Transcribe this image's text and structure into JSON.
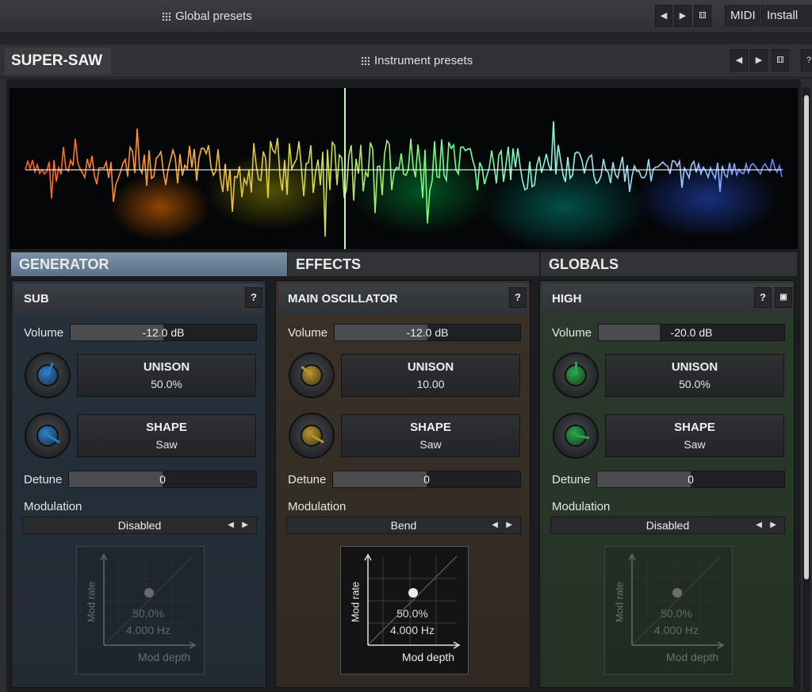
{
  "top": {
    "presets": "Global presets",
    "midi": "MIDI",
    "install": "Install pr"
  },
  "instrument": {
    "name": "SUPER-SAW",
    "presets": "Instrument presets"
  },
  "tabs": [
    "GENERATOR",
    "EFFECTS",
    "GLOBALS"
  ],
  "panels": [
    {
      "title": "SUB",
      "volume_label": "Volume",
      "volume": "-12.0 dB",
      "volume_fraction": 0.5,
      "unison_title": "UNISON",
      "unison_value": "50.0%",
      "shape_title": "SHAPE",
      "shape_value": "Saw",
      "detune_label": "Detune",
      "detune": "0",
      "detune_fraction": 0.5,
      "modulation_label": "Modulation",
      "modulation": "Disabled",
      "mod_y": "Mod rate",
      "mod_x": "Mod depth",
      "mod_depth": "50.0%",
      "mod_rate": "4.000 Hz",
      "accent": "#2f7fc6"
    },
    {
      "title": "MAIN OSCILLATOR",
      "volume_label": "Volume",
      "volume": "-12.0 dB",
      "volume_fraction": 0.5,
      "unison_title": "UNISON",
      "unison_value": "10.00",
      "shape_title": "SHAPE",
      "shape_value": "Saw",
      "detune_label": "Detune",
      "detune": "0",
      "detune_fraction": 0.5,
      "modulation_label": "Modulation",
      "modulation": "Bend",
      "mod_y": "Mod rate",
      "mod_x": "Mod depth",
      "mod_depth": "50.0%",
      "mod_rate": "4.000 Hz",
      "accent": "#b8962e"
    },
    {
      "title": "HIGH",
      "volume_label": "Volume",
      "volume": "-20.0 dB",
      "volume_fraction": 0.33,
      "unison_title": "UNISON",
      "unison_value": "50.0%",
      "shape_title": "SHAPE",
      "shape_value": "Saw",
      "detune_label": "Detune",
      "detune": "0",
      "detune_fraction": 0.5,
      "modulation_label": "Modulation",
      "modulation": "Disabled",
      "mod_y": "Mod rate",
      "mod_x": "Mod depth",
      "mod_depth": "50.0%",
      "mod_rate": "4.000 Hz",
      "accent": "#2aa84a"
    }
  ],
  "help": "?"
}
